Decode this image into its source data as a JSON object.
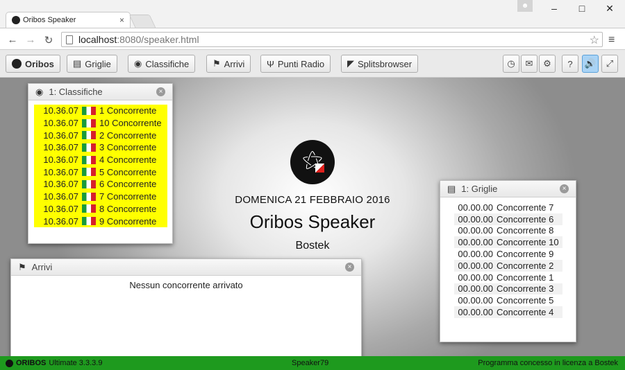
{
  "browser": {
    "tab_title": "Oribos Speaker",
    "tab_close": "×",
    "url_host": "localhost",
    "url_path": ":8080/speaker.html",
    "window_controls": {
      "minimize": "–",
      "maximize": "□",
      "close": "✕"
    }
  },
  "toolbar": {
    "brand_label": "Oribos",
    "buttons": [
      {
        "label": "Griglie",
        "icon": "list-icon"
      },
      {
        "label": "Classifiche",
        "icon": "medal-icon"
      },
      {
        "label": "Arrivi",
        "icon": "checkered-flag-icon"
      },
      {
        "label": "Punti Radio",
        "icon": "radio-icon"
      },
      {
        "label": "Splitsbrowser",
        "icon": "chart-icon"
      }
    ],
    "right_icons": [
      "clock-icon",
      "chat-icon",
      "gear-icon",
      "help-icon",
      "speaker-icon",
      "fullscreen-icon"
    ]
  },
  "center": {
    "date": "DOMENICA 21 FEBBRAIO 2016",
    "title": "Oribos Speaker",
    "organization": "Bostek"
  },
  "classifiche": {
    "title": "1: Classifiche",
    "rows": [
      {
        "time": "10.36.07",
        "name": "1 Concorrente"
      },
      {
        "time": "10.36.07",
        "name": "10 Concorrente"
      },
      {
        "time": "10.36.07",
        "name": "2 Concorrente"
      },
      {
        "time": "10.36.07",
        "name": "3 Concorrente"
      },
      {
        "time": "10.36.07",
        "name": "4 Concorrente"
      },
      {
        "time": "10.36.07",
        "name": "5 Concorrente"
      },
      {
        "time": "10.36.07",
        "name": "6 Concorrente"
      },
      {
        "time": "10.36.07",
        "name": "7 Concorrente"
      },
      {
        "time": "10.36.07",
        "name": "8 Concorrente"
      },
      {
        "time": "10.36.07",
        "name": "9 Concorrente"
      }
    ],
    "highlight_color": "#ffff00"
  },
  "griglie": {
    "title": "1: Griglie",
    "rows": [
      {
        "time": "00.00.00",
        "name": "Concorrente 7"
      },
      {
        "time": "00.00.00",
        "name": "Concorrente 6"
      },
      {
        "time": "00.00.00",
        "name": "Concorrente 8"
      },
      {
        "time": "00.00.00",
        "name": "Concorrente 10"
      },
      {
        "time": "00.00.00",
        "name": "Concorrente 9"
      },
      {
        "time": "00.00.00",
        "name": "Concorrente 2"
      },
      {
        "time": "00.00.00",
        "name": "Concorrente 1"
      },
      {
        "time": "00.00.00",
        "name": "Concorrente 3"
      },
      {
        "time": "00.00.00",
        "name": "Concorrente 5"
      },
      {
        "time": "00.00.00",
        "name": "Concorrente 4"
      }
    ]
  },
  "arrivi": {
    "title": "Arrivi",
    "empty_message": "Nessun concorrente arrivato"
  },
  "statusbar": {
    "brand": "ORIBOS",
    "version": "Ultimate 3.3.3.9",
    "user": "Speaker79",
    "license": "Programma concesso in licenza a Bostek",
    "color": "#1e9a1e"
  }
}
